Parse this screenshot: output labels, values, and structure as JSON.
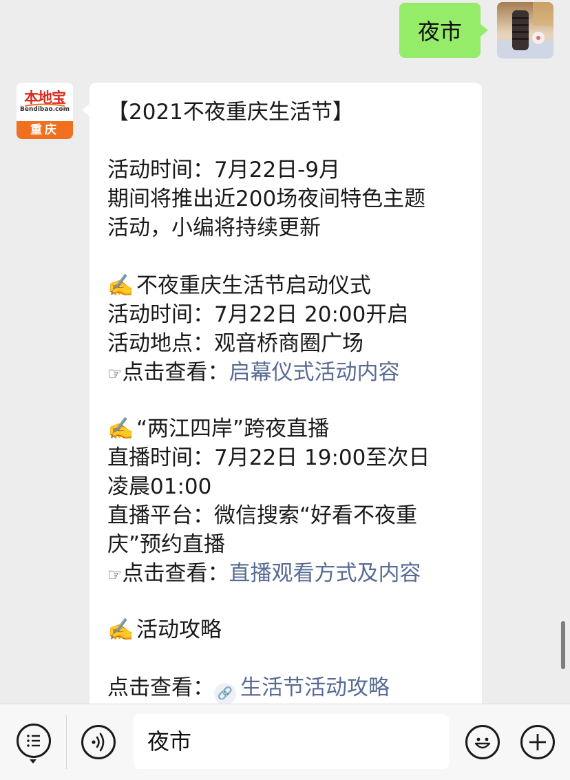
{
  "outgoing": {
    "text": "夜市"
  },
  "sender": {
    "logo_text": "本地宝",
    "logo_sub": "Bendibao.com",
    "city": "重庆"
  },
  "message": {
    "title": "【2021不夜重庆生活节】",
    "intro": [
      "活动时间：7月22日-9月",
      "期间将推出近200场夜间特色主题",
      "活动，小编将持续更新"
    ],
    "sections": [
      {
        "icon": "✍️",
        "title": "不夜重庆生活节启动仪式",
        "lines": [
          "活动时间：7月22日 20:00开启",
          "活动地点：观音桥商圈广场"
        ],
        "link_prefix": "点击查看：",
        "link_text": "启幕仪式活动内容"
      },
      {
        "icon": "✍️",
        "title": "“两江四岸”跨夜直播",
        "lines": [
          "直播时间：7月22日 19:00至次日",
          "凌晨01:00",
          "直播平台：微信搜索“好看不夜重",
          "庆”预约直播"
        ],
        "link_prefix": "点击查看：",
        "link_text": "直播观看方式及内容"
      },
      {
        "icon": "✍️",
        "title": "活动攻略",
        "link_prefix": "点击查看：",
        "link_text": "生活节活动攻略"
      }
    ],
    "pointer_icon": "☞"
  },
  "input_bar": {
    "value": "夜市",
    "icons": [
      "menu-list-icon",
      "voice-icon",
      "emoji-icon",
      "plus-icon"
    ]
  },
  "colors": {
    "outgoing_bubble": "#95ec69",
    "link": "#576b95",
    "background": "#ededed"
  }
}
